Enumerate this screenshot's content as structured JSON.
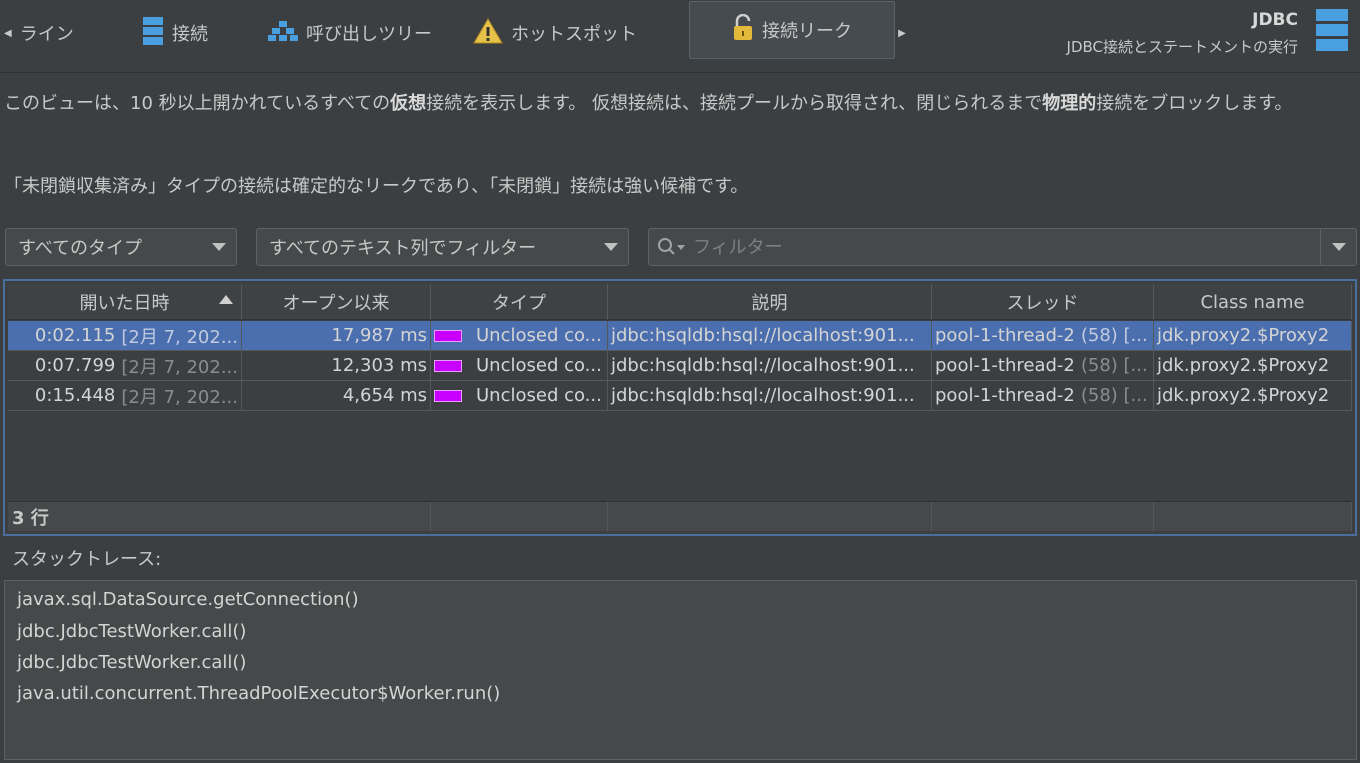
{
  "toolbar": {
    "tabs": [
      {
        "label": "ライン",
        "icon": "chevron-left-icon"
      },
      {
        "label": "接続",
        "icon": "database-icon"
      },
      {
        "label": "呼び出しツリー",
        "icon": "call-tree-icon"
      },
      {
        "label": "ホットスポット",
        "icon": "warning-icon"
      },
      {
        "label": "接続リーク",
        "icon": "unlock-icon"
      }
    ],
    "active_tab": "接続リーク",
    "title": "JDBC",
    "subtitle": "JDBC接続とステートメントの実行"
  },
  "description": {
    "p1_a": "このビューは、10 秒以上開かれているすべての",
    "p1_bold1": "仮想",
    "p1_b": "接続を表示します。 仮想接続は、接続プールから取得され、閉じられるまで",
    "p1_bold2": "物理的",
    "p1_c": "接続をブロックします。",
    "p2": "「未閉鎖収集済み」タイプの接続は確定的なリークであり、「未閉鎖」接続は強い候補です。"
  },
  "filters": {
    "type_select": "すべてのタイプ",
    "column_select": "すべてのテキスト列でフィルター",
    "filter_placeholder": "フィルター"
  },
  "table": {
    "columns": [
      "開いた日時",
      "オープン以来",
      "タイプ",
      "説明",
      "スレッド",
      "Class name"
    ],
    "rows": [
      {
        "time": "0:02.115",
        "date": "[2月 7, 202...",
        "since": "17,987 ms",
        "type": "Unclosed co...",
        "desc": "jdbc:hsqldb:hsql://localhost:901...",
        "thread": "pool-1-thread-2",
        "thread_id": "(58) [...",
        "class": "jdk.proxy2.$Proxy2",
        "selected": true
      },
      {
        "time": "0:07.799",
        "date": "[2月 7, 202...",
        "since": "12,303 ms",
        "type": "Unclosed co...",
        "desc": "jdbc:hsqldb:hsql://localhost:901...",
        "thread": "pool-1-thread-2",
        "thread_id": "(58) [...",
        "class": "jdk.proxy2.$Proxy2",
        "selected": false
      },
      {
        "time": "0:15.448",
        "date": "[2月 7, 202...",
        "since": "4,654 ms",
        "type": "Unclosed co...",
        "desc": "jdbc:hsqldb:hsql://localhost:901...",
        "thread": "pool-1-thread-2",
        "thread_id": "(58) [...",
        "class": "jdk.proxy2.$Proxy2",
        "selected": false
      }
    ],
    "footer": "3 行",
    "type_color": "#c800ff"
  },
  "stack": {
    "label": "スタックトレース:",
    "lines": [
      "javax.sql.DataSource.getConnection()",
      "jdbc.JdbcTestWorker.call()",
      "jdbc.JdbcTestWorker.call()",
      "java.util.concurrent.ThreadPoolExecutor$Worker.run()"
    ]
  }
}
